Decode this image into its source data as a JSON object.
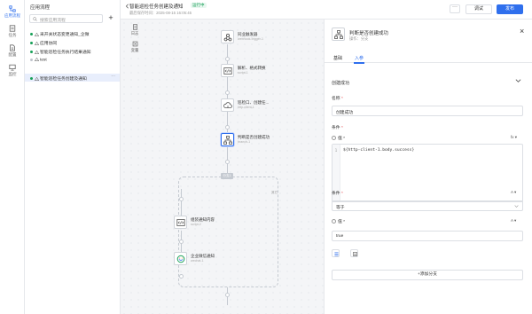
{
  "rail": {
    "items": [
      {
        "label": "应用流程",
        "icon": "flow-icon",
        "active": true
      },
      {
        "label": "任务",
        "icon": "task-icon",
        "active": false
      },
      {
        "label": "配置",
        "icon": "config-icon",
        "active": false
      },
      {
        "label": "监控",
        "icon": "monitor-icon",
        "active": false
      }
    ]
  },
  "flowpanel": {
    "title": "应用流程",
    "search_placeholder": "搜索应用流程",
    "add_label": "+",
    "items": [
      {
        "label": "采开关状态变更通知_企微",
        "dot": "#18a058",
        "active": false
      },
      {
        "label": "应用协同",
        "dot": "#18a058",
        "active": false
      },
      {
        "label": "智能巡检任务执行结果通知",
        "dot": "#18a058",
        "active": false
      },
      {
        "label": "test",
        "dot": "#c0c4cc",
        "active": false
      },
      {
        "label": "智能巡检任务创建及通知",
        "dot": "#18a058",
        "active": true,
        "more": "···"
      }
    ]
  },
  "topbar": {
    "title": "智能巡检任务创建及通知",
    "status": "运行中",
    "subtitle": "最后保存时间：2025-08-15 16:05:45",
    "more_label": "···",
    "debug_label": "调试",
    "publish_label": "发布"
  },
  "side_tools": [
    {
      "label": "日志",
      "icon": "log-icon"
    },
    {
      "label": "变量",
      "icon": "variable-icon"
    }
  ],
  "nodes": [
    {
      "name": "同业触发器",
      "sub": "webhook-trigger-1",
      "icon": "webhook-icon"
    },
    {
      "name": "解析、格式转换",
      "sub": "script-1",
      "icon": "code-icon"
    },
    {
      "name": "巡检口、创建任...",
      "sub": "http-client-1",
      "icon": "http-icon"
    },
    {
      "name": "判断是否创建成功",
      "sub": "branch-1",
      "icon": "branch-icon"
    },
    {
      "name": "组装通知内容",
      "sub": "script-2",
      "icon": "code-icon"
    },
    {
      "name": "企业微信通知",
      "sub": "wechat-1",
      "icon": "wechat-icon"
    }
  ],
  "branch": {
    "tag": "分支1",
    "other": "其它"
  },
  "panel": {
    "title": "判断是否创建成功",
    "subtitle": "操作：分支",
    "close_label": "×",
    "tabs": [
      {
        "label": "基础"
      },
      {
        "label": "入参"
      }
    ],
    "section_label": "创建成功",
    "name_label": "名称",
    "name_value": "创建成功",
    "condition_label": "条件",
    "radio_value_label": "值",
    "fx_label": "fx",
    "code_line_number": "1",
    "code_text": "${http-client-1.body.success}",
    "operator_label": "条件",
    "operator_type": "A",
    "operator_value": "等于",
    "value_label": "值",
    "value_type": "A",
    "value_value": "true",
    "add_branch_label": "+添加分支"
  }
}
